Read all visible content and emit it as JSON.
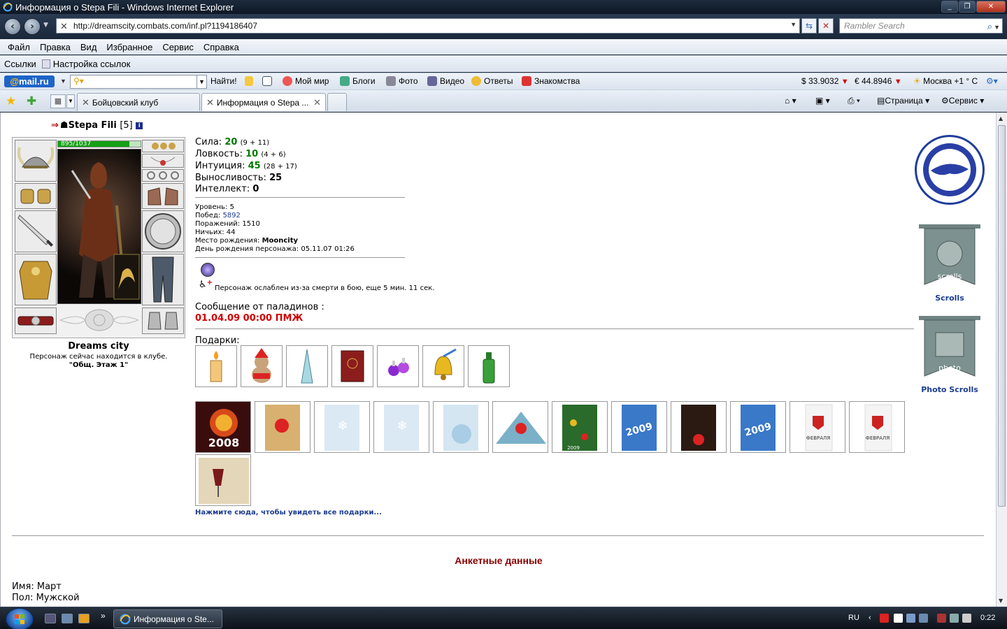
{
  "window": {
    "title": "Информация о Stepa Fili - Windows Internet Explorer"
  },
  "address": {
    "url": "http://dreamscity.combats.com/inf.pl?1194186407",
    "search_placeholder": "Rambler Search"
  },
  "menu": [
    "Файл",
    "Правка",
    "Вид",
    "Избранное",
    "Сервис",
    "Справка"
  ],
  "links_bar": {
    "label": "Ссылки",
    "settings": "Настройка ссылок"
  },
  "mail_toolbar": {
    "logo_prefix": "@",
    "logo_text": "mail",
    "logo_suffix": ".ru",
    "find": "Найти!",
    "items": [
      "Мой мир",
      "Блоги",
      "Фото",
      "Видео",
      "Ответы",
      "Знакомства"
    ],
    "usd": "$ 33.9032",
    "eur": "€ 44.8946",
    "weather": "Москва +1 ° С"
  },
  "tabs": [
    {
      "label": "Бойцовский клуб",
      "active": false
    },
    {
      "label": "Информация о Stepa ...",
      "active": true
    }
  ],
  "command_bar": {
    "page": "Страница",
    "service": "Сервис"
  },
  "character": {
    "name": "Stepa Fili",
    "level": "[5]",
    "hp_text": "895/1037",
    "hp_fraction": 0.863,
    "city": "Dreams city",
    "location_text": "Персонаж сейчас находится в клубе.",
    "location_room": "\"Общ. Этаж 1\""
  },
  "stats": [
    {
      "label": "Сила:",
      "value": "20",
      "detail": "(9 + 11)",
      "colored": true
    },
    {
      "label": "Ловкость:",
      "value": "10",
      "detail": "(4 + 6)",
      "colored": true
    },
    {
      "label": "Интуиция:",
      "value": "45",
      "detail": "(28 + 17)",
      "colored": true
    },
    {
      "label": "Выносливость:",
      "value": "25",
      "detail": "",
      "colored": false
    },
    {
      "label": "Интеллект:",
      "value": "0",
      "detail": "",
      "colored": false
    }
  ],
  "details": {
    "level_label": "Уровень:",
    "level_value": "5",
    "wins_label": "Побед:",
    "wins_value": "5892",
    "losses_label": "Поражений:",
    "losses_value": "1510",
    "draws_label": "Ничьих:",
    "draws_value": "44",
    "birthplace_label": "Место рождения:",
    "birthplace_value": "Mooncity",
    "birthday_label": "День рождения персонажа:",
    "birthday_value": "05.11.07 01:26"
  },
  "status": {
    "weakness": "Персонаж ослаблен из-за смерти в бою, еще 5 мин. 11 сек.",
    "paladin_label": "Сообщение от паладинов :",
    "paladin_msg": "01.04.09 00:00 ПМЖ"
  },
  "gifts": {
    "label": "Подарки:",
    "more": "Нажмите сюда, чтобы увидеть все подарки..."
  },
  "cards_text": {
    "c0": "2008",
    "c6": "2009",
    "c7": "2009",
    "c9": "2009",
    "c10": "ФЕВРАЛЯ",
    "c11": "ФЕВРАЛЯ"
  },
  "right_panel": {
    "scrolls": "Scrolls",
    "photo_scrolls": "Photo Scrolls",
    "scrolls_banner": "scrolls",
    "photo_banner": "photo"
  },
  "anketa": {
    "title": "Анкетные данные",
    "name_label": "Имя:",
    "name_value": "Март",
    "sex_label": "Пол:",
    "sex_value": "Мужской"
  },
  "taskbar": {
    "task": "Информация о Ste...",
    "lang": "RU",
    "time": "0:22"
  }
}
